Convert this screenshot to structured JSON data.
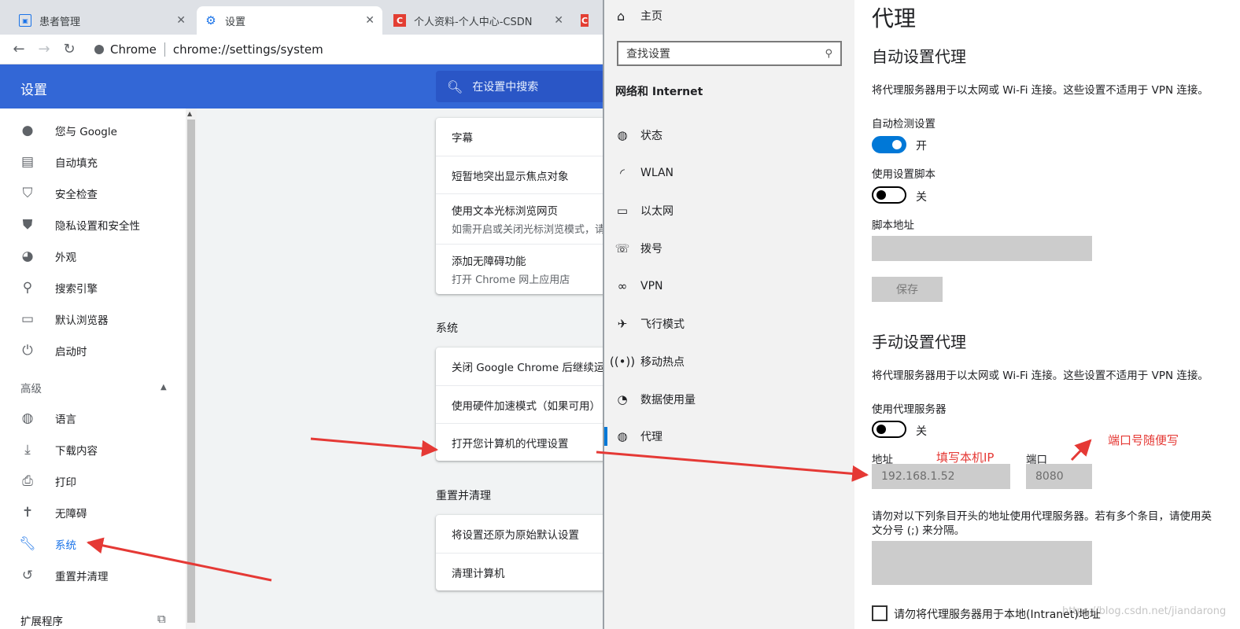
{
  "chrome": {
    "tabs": [
      {
        "title": "患者管理",
        "icon": "app-icon"
      },
      {
        "title": "设置",
        "icon": "gear-icon"
      },
      {
        "title": "个人资料-个人中心-CSDN",
        "icon": "csdn-logo-icon"
      }
    ],
    "address": {
      "site": "Chrome",
      "url": "chrome://settings/system"
    },
    "settings_title": "设置",
    "search_placeholder": "在设置中搜索",
    "sidebar": {
      "items": [
        {
          "label": "您与 Google",
          "icon": "person-icon"
        },
        {
          "label": "自动填充",
          "icon": "clipboard-icon"
        },
        {
          "label": "安全检查",
          "icon": "shield-check-icon"
        },
        {
          "label": "隐私设置和安全性",
          "icon": "shield-icon"
        },
        {
          "label": "外观",
          "icon": "palette-icon"
        },
        {
          "label": "搜索引擎",
          "icon": "search-icon"
        },
        {
          "label": "默认浏览器",
          "icon": "browser-icon"
        },
        {
          "label": "启动时",
          "icon": "power-icon"
        }
      ],
      "advanced_label": "高级",
      "advanced_items": [
        {
          "label": "语言",
          "icon": "globe-icon"
        },
        {
          "label": "下载内容",
          "icon": "download-icon"
        },
        {
          "label": "打印",
          "icon": "printer-icon"
        },
        {
          "label": "无障碍",
          "icon": "accessibility-icon"
        },
        {
          "label": "系统",
          "icon": "wrench-icon"
        },
        {
          "label": "重置并清理",
          "icon": "history-icon"
        }
      ],
      "extensions_label": "扩展程序"
    },
    "accessibility_card": [
      {
        "title": "字幕"
      },
      {
        "title": "短暂地突出显示焦点对象"
      },
      {
        "title": "使用文本光标浏览网页",
        "sub": "如需开启或关闭光标浏览模式，请"
      },
      {
        "title": "添加无障碍功能",
        "sub": "打开 Chrome 网上应用店"
      }
    ],
    "system_section": {
      "title": "系统",
      "rows": [
        "关闭 Google Chrome 后继续运行后",
        "使用硬件加速模式（如果可用）",
        "打开您计算机的代理设置"
      ]
    },
    "reset_section": {
      "title": "重置并清理",
      "rows": [
        "将设置还原为原始默认设置",
        "清理计算机"
      ]
    }
  },
  "windows": {
    "home": "主页",
    "search_placeholder": "查找设置",
    "category": "网络和 Internet",
    "nav": [
      {
        "label": "状态",
        "icon": "globe-status-icon"
      },
      {
        "label": "WLAN",
        "icon": "wifi-icon"
      },
      {
        "label": "以太网",
        "icon": "ethernet-icon"
      },
      {
        "label": "拨号",
        "icon": "dialup-icon"
      },
      {
        "label": "VPN",
        "icon": "vpn-icon"
      },
      {
        "label": "飞行模式",
        "icon": "airplane-icon"
      },
      {
        "label": "移动热点",
        "icon": "hotspot-icon"
      },
      {
        "label": "数据使用量",
        "icon": "pie-icon"
      },
      {
        "label": "代理",
        "icon": "globe-icon"
      }
    ],
    "proxy": {
      "title": "代理",
      "auto_heading": "自动设置代理",
      "auto_desc": "将代理服务器用于以太网或 Wi-Fi 连接。这些设置不适用于 VPN 连接。",
      "auto_detect_label": "自动检测设置",
      "auto_detect_state": "开",
      "script_label": "使用设置脚本",
      "script_state": "关",
      "script_address_label": "脚本地址",
      "save_label": "保存",
      "manual_heading": "手动设置代理",
      "manual_desc": "将代理服务器用于以太网或 Wi-Fi 连接。这些设置不适用于 VPN 连接。",
      "use_proxy_label": "使用代理服务器",
      "use_proxy_state": "关",
      "address_label": "地址",
      "address_value": "192.168.1.52",
      "port_label": "端口",
      "port_value": "8080",
      "exceptions_desc_1": "请勿对以下列条目开头的地址使用代理服务器。若有多个条目，请使用英",
      "exceptions_desc_2": "文分号 (;) 来分隔。",
      "local_checkbox_label": "请勿将代理服务器用于本地(Intranet)地址"
    }
  },
  "annotations": {
    "fill_ip": "填写本机IP",
    "port_any": "端口号随便写",
    "color": "#e53935"
  },
  "watermark": "https://blog.csdn.net/jiandarong"
}
